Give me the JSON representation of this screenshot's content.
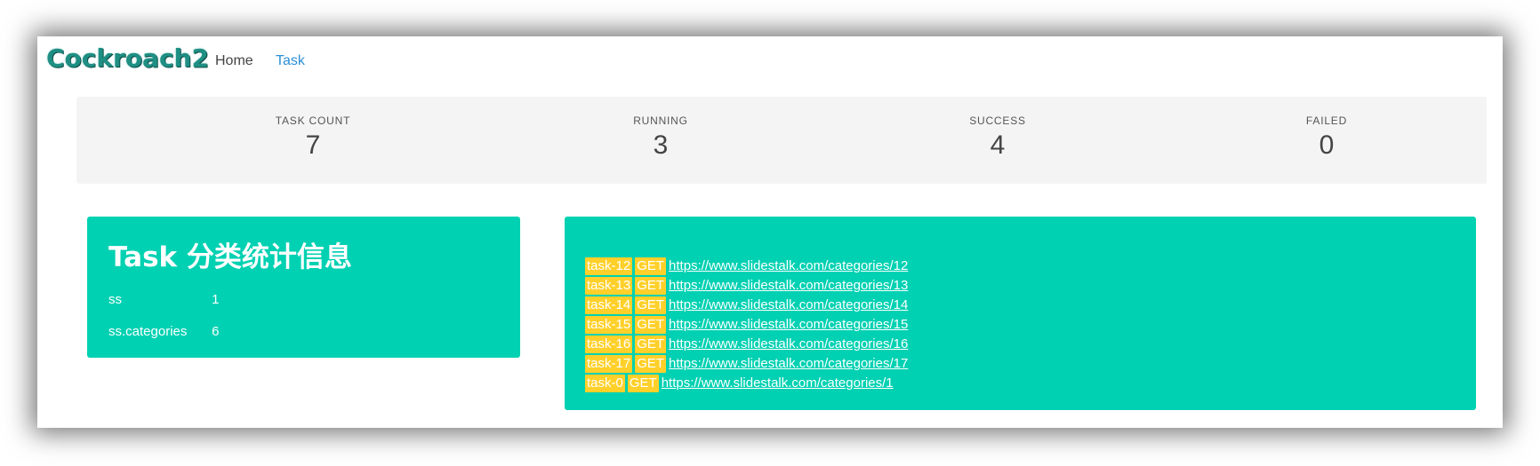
{
  "brand": "Cockroach2",
  "nav": {
    "home": "Home",
    "task": "Task"
  },
  "stats": [
    {
      "label": "TASK COUNT",
      "value": "7"
    },
    {
      "label": "RUNNING",
      "value": "3"
    },
    {
      "label": "SUCCESS",
      "value": "4"
    },
    {
      "label": "FAILED",
      "value": "0"
    }
  ],
  "category_panel": {
    "title": "Task 分类统计信息",
    "rows": [
      {
        "name": "ss",
        "count": "1"
      },
      {
        "name": "ss.categories",
        "count": "6"
      }
    ]
  },
  "tasks": [
    {
      "id": "task-12",
      "method": "GET",
      "url": "https://www.slidestalk.com/categories/12"
    },
    {
      "id": "task-13",
      "method": "GET",
      "url": "https://www.slidestalk.com/categories/13"
    },
    {
      "id": "task-14",
      "method": "GET",
      "url": "https://www.slidestalk.com/categories/14"
    },
    {
      "id": "task-15",
      "method": "GET",
      "url": "https://www.slidestalk.com/categories/15"
    },
    {
      "id": "task-16",
      "method": "GET",
      "url": "https://www.slidestalk.com/categories/16"
    },
    {
      "id": "task-17",
      "method": "GET",
      "url": "https://www.slidestalk.com/categories/17"
    },
    {
      "id": "task-0",
      "method": "GET",
      "url": "https://www.slidestalk.com/categories/1"
    }
  ],
  "colors": {
    "accent": "#00d1b2",
    "tag": "#ffd02a",
    "brand": "#1f8f84",
    "active_link": "#2c8fd6"
  }
}
